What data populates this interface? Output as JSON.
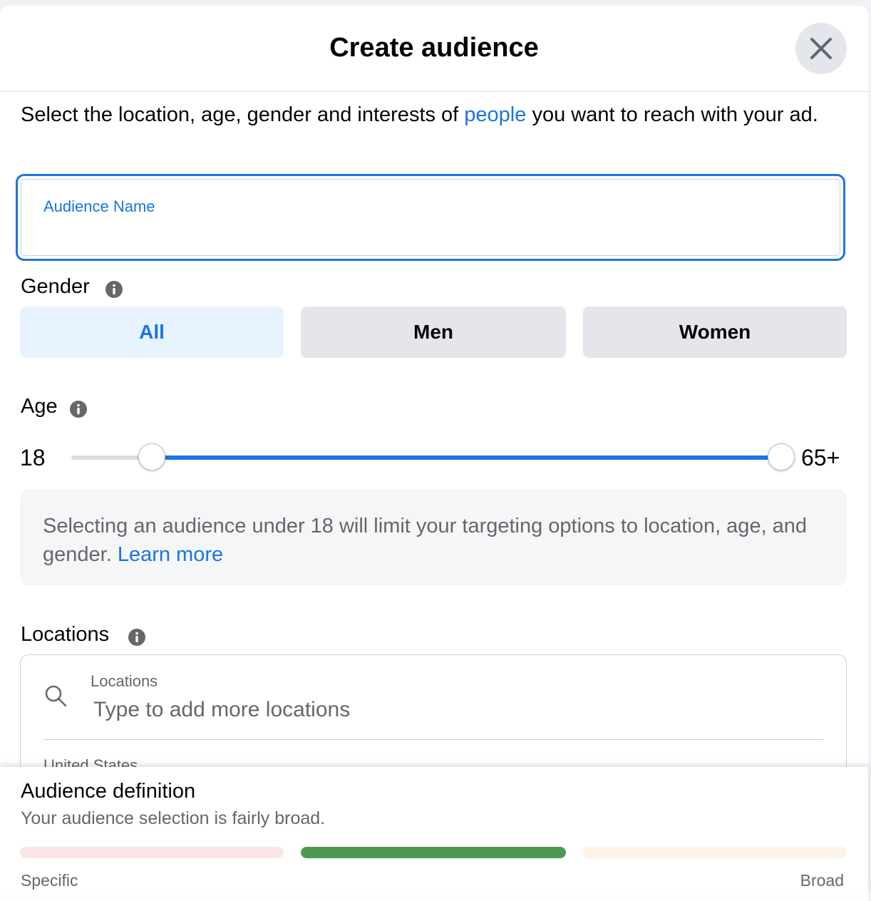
{
  "dialog": {
    "title": "Create audience",
    "close_label": "Close"
  },
  "intro": {
    "before": "Select the location, age, gender and interests of ",
    "link": "people",
    "after": " you want to reach with your ad."
  },
  "audience_name": {
    "label": "Audience Name",
    "value": ""
  },
  "gender": {
    "label": "Gender",
    "options": [
      "All",
      "Men",
      "Women"
    ],
    "selected": "All"
  },
  "age": {
    "label": "Age",
    "min_label": "18",
    "max_label": "65+",
    "notice": "Selecting an audience under 18 will limit your targeting options to location, age, and gender. ",
    "notice_link": "Learn more"
  },
  "locations": {
    "label": "Locations",
    "field_label": "Locations",
    "placeholder": "Type to add more locations",
    "selected_country": "United States"
  },
  "audience_definition": {
    "title": "Audience definition",
    "subtitle": "Your audience selection is fairly broad.",
    "left_label": "Specific",
    "right_label": "Broad",
    "colors": {
      "specific": "#fce4e6",
      "current": "#4c9a52",
      "broad": "#fdf3e4"
    }
  },
  "theme": {
    "accent": "#1b74e4"
  }
}
